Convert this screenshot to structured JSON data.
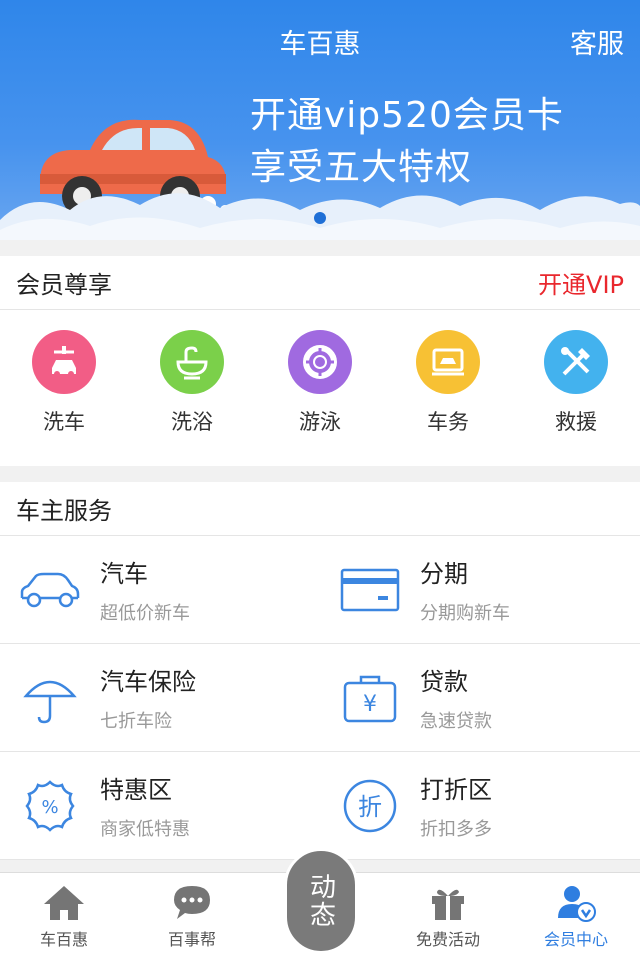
{
  "header": {
    "title": "车百惠",
    "service_label": "客服"
  },
  "banner": {
    "line1": "开通vip520会员卡",
    "line2": "享受五大特权",
    "dots": 3,
    "active_dot": 2
  },
  "member": {
    "title": "会员尊享",
    "action_label": "开通VIP",
    "items": [
      {
        "label": "洗车",
        "icon": "car-wash-icon",
        "color": "#f25d86"
      },
      {
        "label": "洗浴",
        "icon": "bathtub-icon",
        "color": "#7bd04a"
      },
      {
        "label": "游泳",
        "icon": "lifebuoy-icon",
        "color": "#a06ae0"
      },
      {
        "label": "车务",
        "icon": "car-service-icon",
        "color": "#f7c134"
      },
      {
        "label": "救援",
        "icon": "tools-icon",
        "color": "#43b2ee"
      }
    ]
  },
  "owner": {
    "title": "车主服务",
    "items": [
      {
        "name": "汽车",
        "sub": "超低价新车",
        "icon": "car-outline-icon"
      },
      {
        "name": "分期",
        "sub": "分期购新车",
        "icon": "card-icon"
      },
      {
        "name": "汽车保险",
        "sub": "七折车险",
        "icon": "umbrella-icon"
      },
      {
        "name": "贷款",
        "sub": "急速贷款",
        "icon": "yen-bag-icon"
      },
      {
        "name": "特惠区",
        "sub": "商家低特惠",
        "icon": "percent-badge-icon"
      },
      {
        "name": "打折区",
        "sub": "折扣多多",
        "icon": "discount-icon"
      }
    ]
  },
  "tabbar": {
    "items": [
      {
        "label": "车百惠",
        "icon": "home-icon",
        "active": false
      },
      {
        "label": "百事帮",
        "icon": "chat-icon",
        "active": false
      },
      {
        "label": "免费活动",
        "icon": "gift-icon",
        "active": false
      },
      {
        "label": "会员中心",
        "icon": "member-icon",
        "active": true
      }
    ],
    "center_label": "动态"
  },
  "colors": {
    "accent": "#2f7ee0",
    "vip": "#e9272d",
    "banner": "#2f86ea"
  }
}
